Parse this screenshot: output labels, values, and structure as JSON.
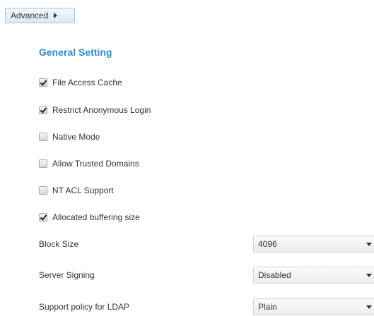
{
  "advanced_button": {
    "label": "Advanced",
    "icon": "caret-right-icon"
  },
  "general_setting": {
    "title": "General Setting",
    "options": [
      {
        "label": "File Access Cache",
        "checked": true
      },
      {
        "label": "Restrict Anonymous Login",
        "checked": true
      },
      {
        "label": "Native Mode",
        "checked": false
      },
      {
        "label": "Allow Trusted Domains",
        "checked": false
      },
      {
        "label": "NT ACL Support",
        "checked": false
      },
      {
        "label": "Allocated buffering size",
        "checked": true
      }
    ],
    "fields": [
      {
        "label": "Block Size",
        "value": "4096"
      },
      {
        "label": "Server Signing",
        "value": "Disabled"
      },
      {
        "label": "Support policy for LDAP",
        "value": "Plain"
      }
    ]
  },
  "colors": {
    "section_title": "#2a8fc9",
    "text": "#333333"
  }
}
